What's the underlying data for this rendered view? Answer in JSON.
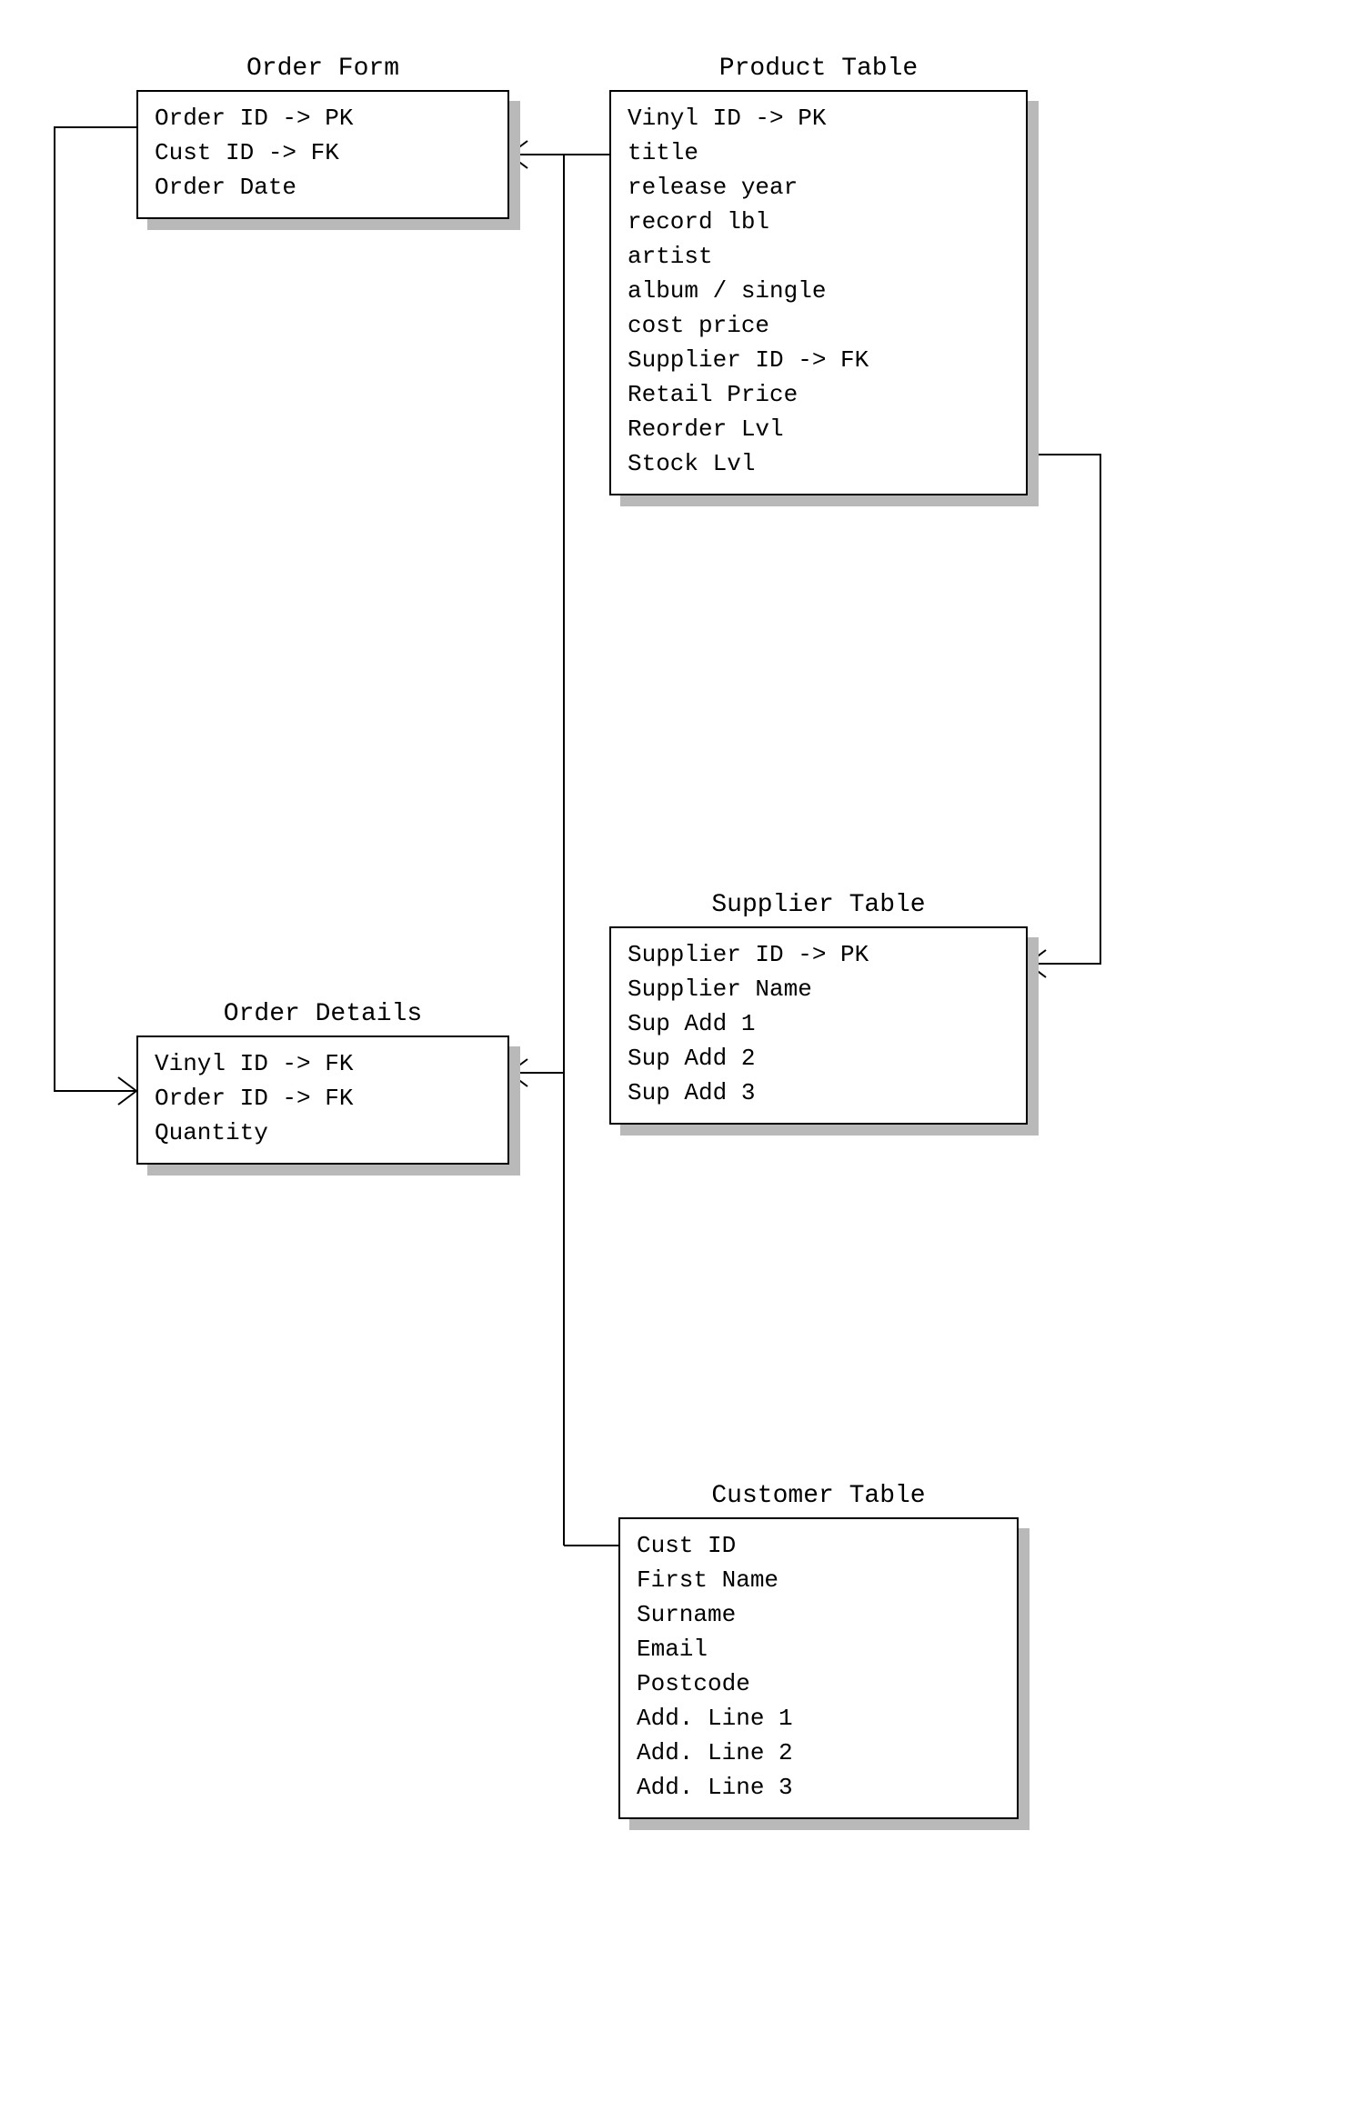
{
  "entities": {
    "order_form": {
      "title": "Order Form",
      "fields": [
        "Order ID -> PK",
        "Cust ID -> FK",
        "Order Date"
      ]
    },
    "product_table": {
      "title": "Product Table",
      "fields": [
        "Vinyl ID -> PK",
        "title",
        "release year",
        "record lbl",
        "artist",
        "album / single",
        "cost price",
        "Supplier ID -> FK",
        "Retail Price",
        "Reorder Lvl",
        "Stock Lvl"
      ]
    },
    "order_details": {
      "title": "Order Details",
      "fields": [
        "Vinyl ID -> FK",
        "Order ID -> FK",
        "Quantity"
      ]
    },
    "supplier_table": {
      "title": "Supplier Table",
      "fields": [
        "Supplier ID -> PK",
        "Supplier Name",
        "Sup Add 1",
        "Sup Add 2",
        "Sup Add 3"
      ]
    },
    "customer_table": {
      "title": "Customer Table",
      "fields": [
        "Cust ID",
        "First Name",
        "Surname",
        "Email",
        "Postcode",
        "Add. Line 1",
        "Add. Line 2",
        "Add. Line 3"
      ]
    }
  }
}
